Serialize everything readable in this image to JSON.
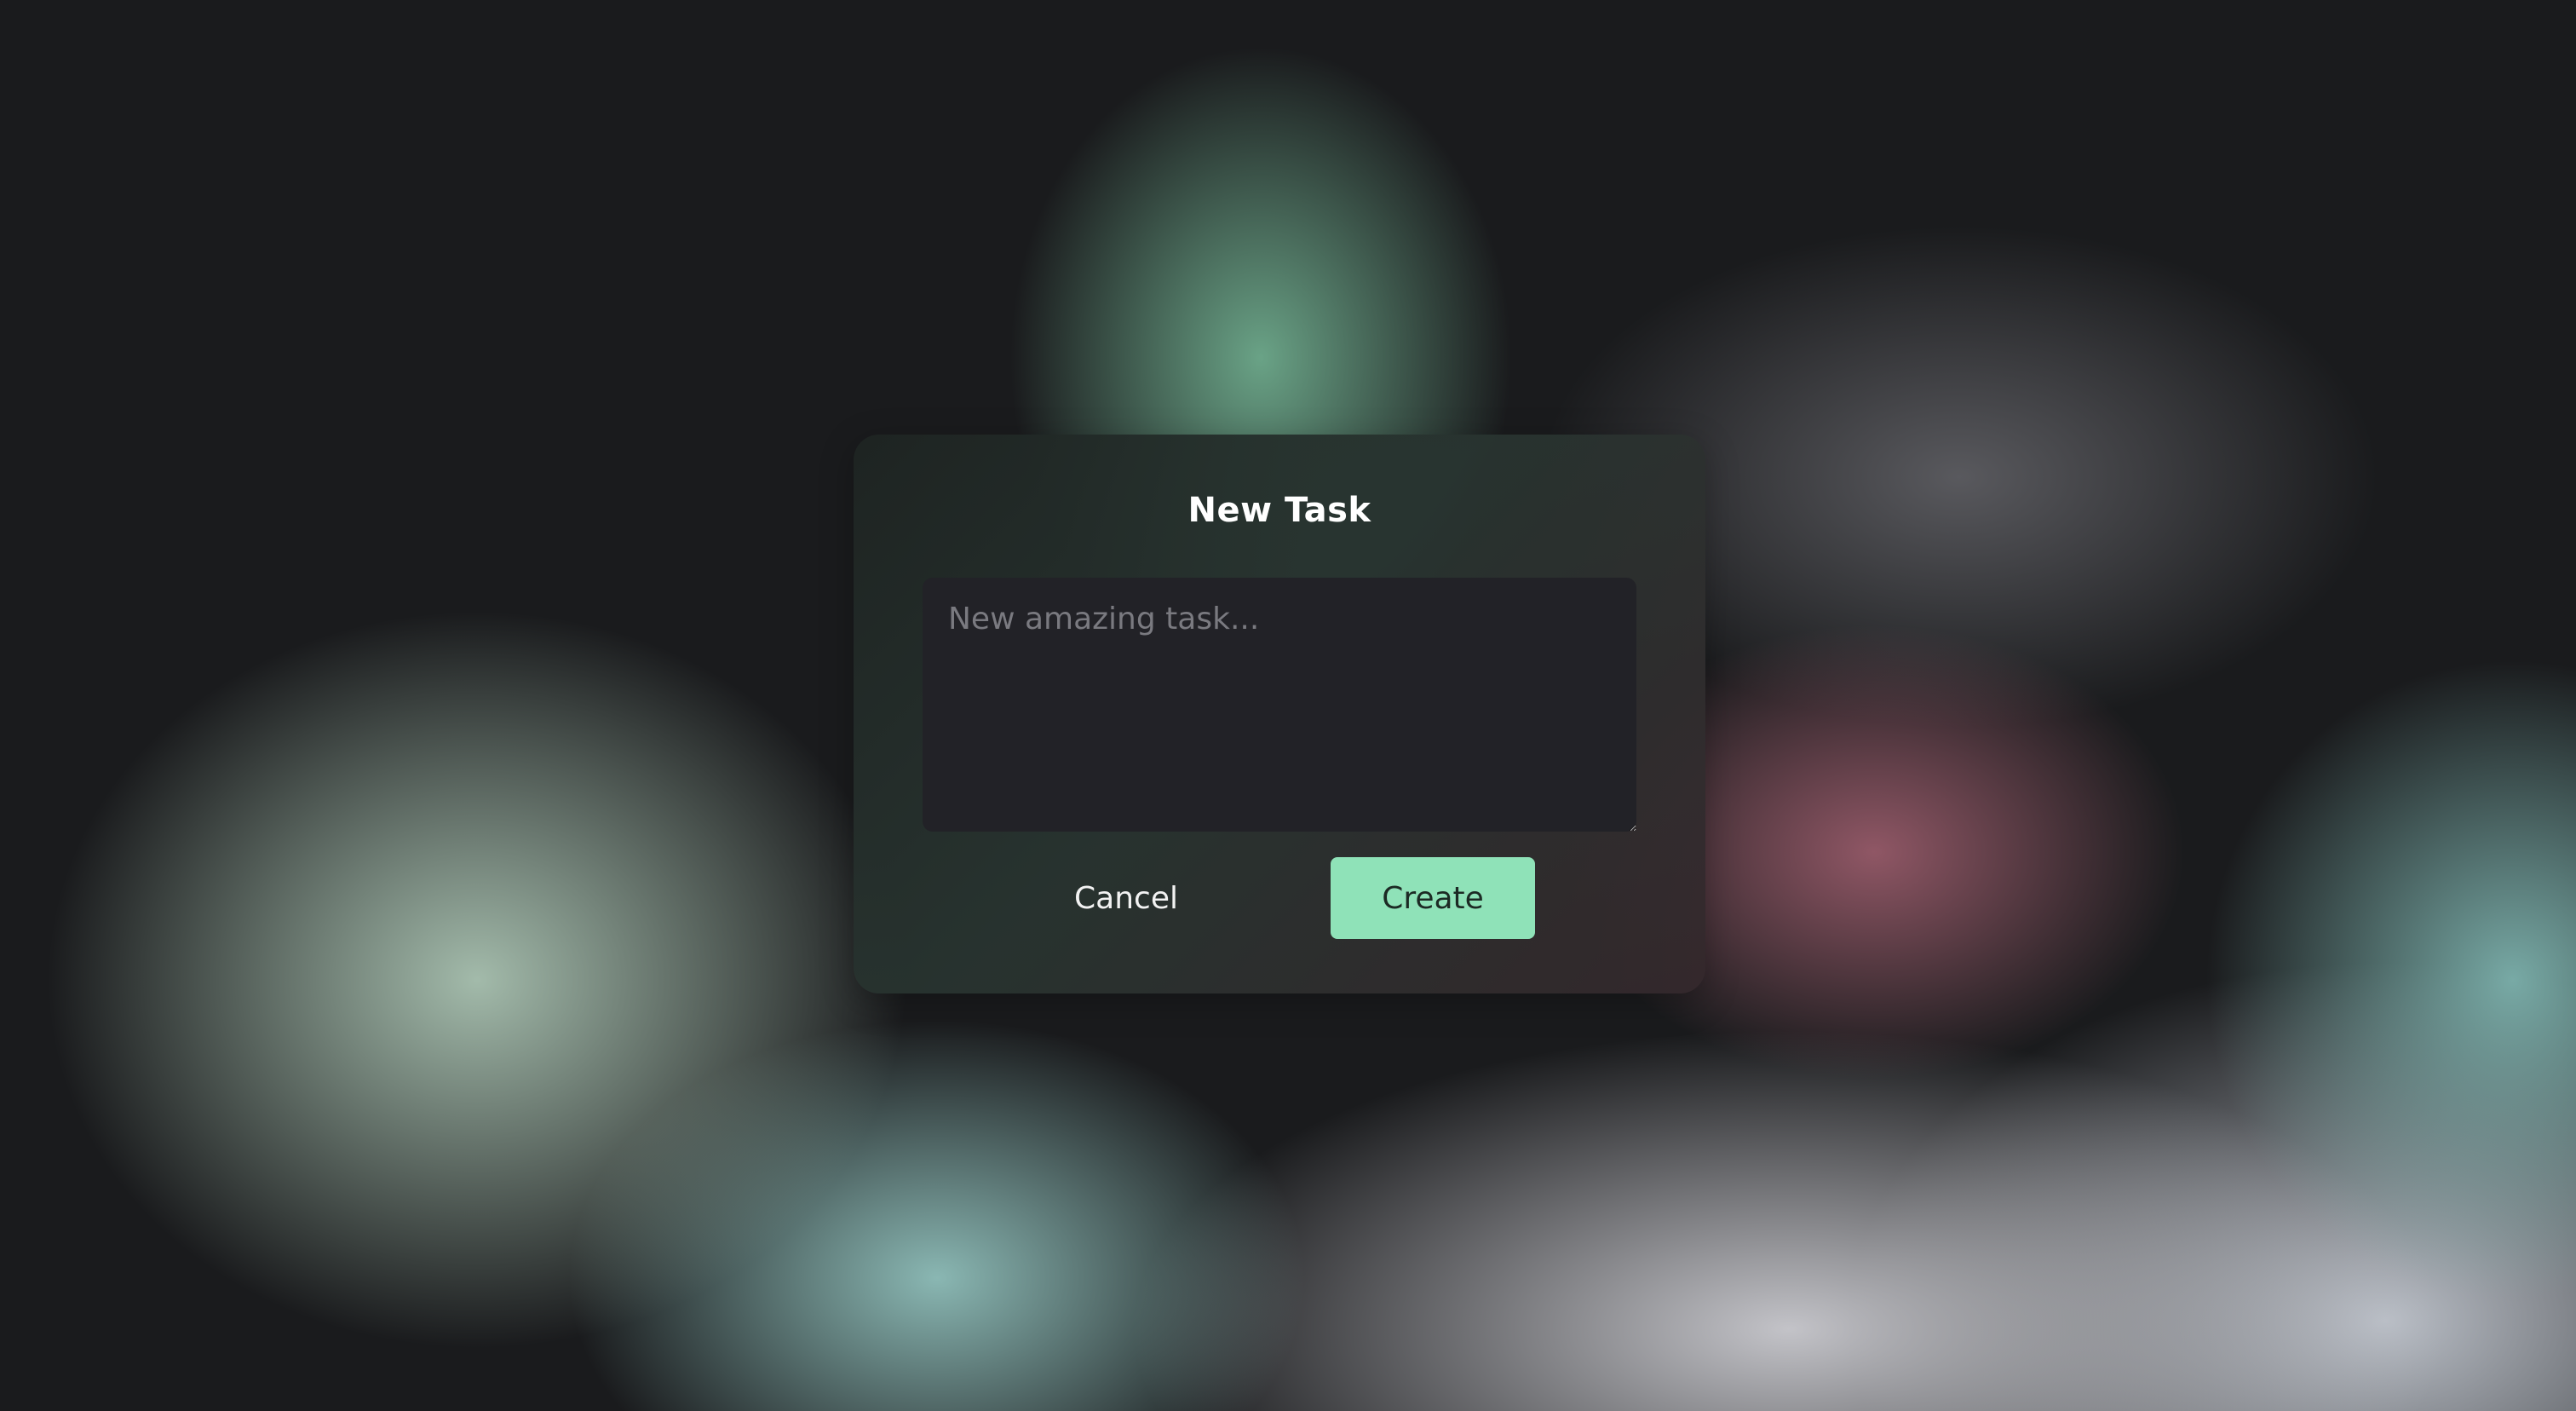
{
  "dialog": {
    "title": "New Task",
    "task_input": {
      "value": "",
      "placeholder": "New amazing task..."
    },
    "cancel_label": "Cancel",
    "create_label": "Create"
  },
  "colors": {
    "accent": "#8fe2b8",
    "dialog_background": "#2a3230",
    "input_background": "#222227"
  }
}
